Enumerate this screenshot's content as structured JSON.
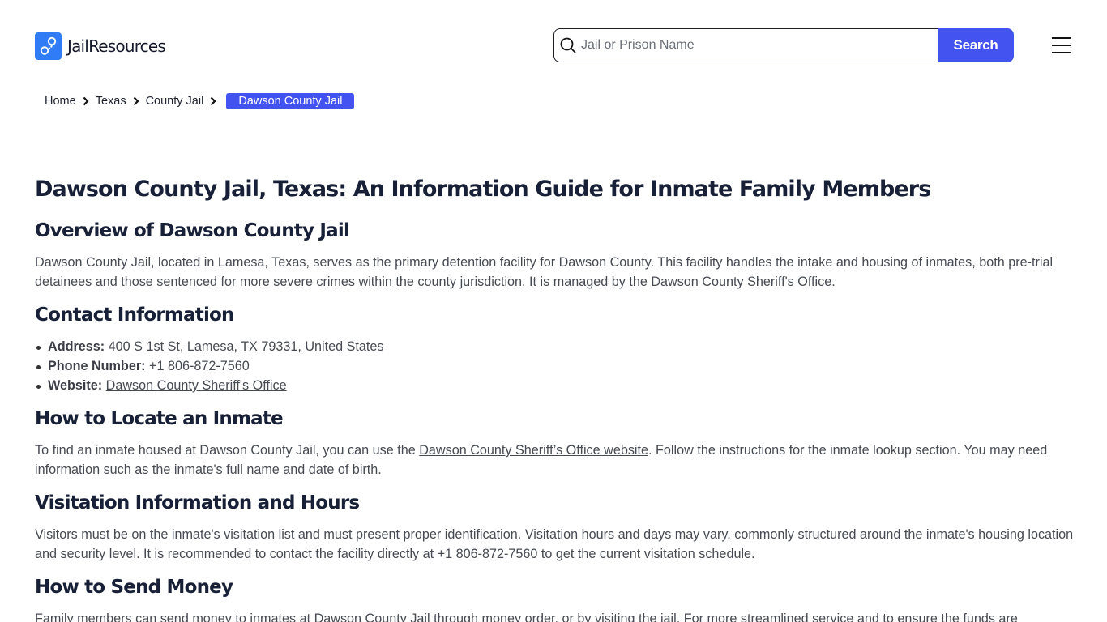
{
  "header": {
    "logo_text": "JailResources",
    "logo_icon": "handcuffs-icon",
    "search": {
      "placeholder": "Jail or Prison Name",
      "value": "",
      "button_label": "Search"
    },
    "menu_icon": "hamburger-menu-icon"
  },
  "breadcrumb": {
    "items": [
      "Home",
      "Texas",
      "County Jail"
    ],
    "current": "Dawson County Jail"
  },
  "page": {
    "title": "Dawson County Jail, Texas: An Information Guide for Inmate Family Members",
    "overview": {
      "heading": "Overview of Dawson County Jail",
      "text": "Dawson County Jail, located in Lamesa, Texas, serves as the primary detention facility for Dawson County. This facility handles the intake and housing of inmates, both pre-trial detainees and those sentenced for more severe crimes within the county jurisdiction. It is managed by the Dawson County Sheriff's Office."
    },
    "contact": {
      "heading": "Contact Information",
      "address_label": "Address:",
      "address": "400 S 1st St, Lamesa, TX 79331, United States",
      "phone_label": "Phone Number:",
      "phone": "+1 806-872-7560",
      "website_label": "Website:",
      "website_link": "Dawson County Sheriff's Office"
    },
    "locate": {
      "heading": "How to Locate an Inmate",
      "text_before": "To find an inmate housed at Dawson County Jail, you can use the ",
      "link": "Dawson County Sheriff’s Office website",
      "text_after": ". Follow the instructions for the inmate lookup section. You may need information such as the inmate's full name and date of birth."
    },
    "visitation": {
      "heading": "Visitation Information and Hours",
      "text": "Visitors must be on the inmate's visitation list and must present proper identification. Visitation hours and days may vary, commonly structured around the inmate's housing location and security level. It is recommended to contact the facility directly at +1 806-872-7560 to get the current visitation schedule."
    },
    "money": {
      "heading": "How to Send Money",
      "text": "Family members can send money to inmates at Dawson County Jail through money order, or by visiting the jail. For more streamlined service and to ensure the funds are"
    }
  },
  "colors": {
    "brand": "#4353f0",
    "logo_blue": "#2f7cf6",
    "heading": "#172036",
    "body_text": "#464a52"
  }
}
